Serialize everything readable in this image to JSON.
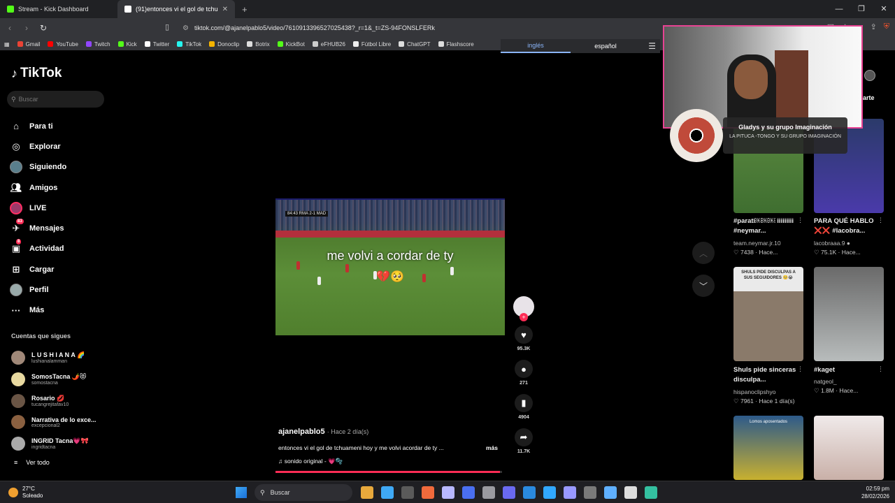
{
  "browser": {
    "tabs": [
      {
        "label": "Stream - Kick Dashboard",
        "color": "#53fc18",
        "active": false
      },
      {
        "label": "(91)entonces vi el gol de tchu",
        "color": "#ffffff",
        "active": true
      }
    ],
    "new_tab": "+",
    "window_controls": [
      "—",
      "❐",
      "✕"
    ],
    "url": "tiktok.com/@ajanelpablo5/video/7610913396527025438?_r=1&_t=ZS-94FONSLFERk",
    "bookmarks": [
      {
        "label": "Gmail",
        "color": "#ea4335"
      },
      {
        "label": "YouTube",
        "color": "#ff0000"
      },
      {
        "label": "Twitch",
        "color": "#9146ff"
      },
      {
        "label": "Kick",
        "color": "#53fc18"
      },
      {
        "label": "Twitter",
        "color": "#ffffff"
      },
      {
        "label": "TikTok",
        "color": "#25f4ee"
      },
      {
        "label": "Donoclip",
        "color": "#f5b400"
      },
      {
        "label": "Botrix",
        "color": "#dddddd"
      },
      {
        "label": "KickBot",
        "color": "#53fc18"
      },
      {
        "label": "eFHUB26",
        "color": "#cccccc"
      },
      {
        "label": "Fútbol Libre",
        "color": "#eeeeee"
      },
      {
        "label": "ChatGPT",
        "color": "#dddddd"
      },
      {
        "label": "Flashscore",
        "color": "#dddddd"
      }
    ],
    "translate": {
      "from": "inglés",
      "to": "español"
    }
  },
  "sidebar": {
    "logo": "TikTok",
    "search_placeholder": "Buscar",
    "nav": [
      {
        "label": "Para ti",
        "icon": "home-icon"
      },
      {
        "label": "Explorar",
        "icon": "compass-icon"
      },
      {
        "label": "Siguiendo",
        "icon": "avatar"
      },
      {
        "label": "Amigos",
        "icon": "friends-icon"
      },
      {
        "label": "LIVE",
        "icon": "live-icon"
      },
      {
        "label": "Mensajes",
        "icon": "message-icon",
        "badge": "83"
      },
      {
        "label": "Actividad",
        "icon": "activity-icon",
        "badge": "8"
      },
      {
        "label": "Cargar",
        "icon": "upload-icon"
      },
      {
        "label": "Perfil",
        "icon": "profile-icon"
      },
      {
        "label": "Más",
        "icon": "more-icon"
      }
    ],
    "following_title": "Cuentas que sigues",
    "following": [
      {
        "name": "L U S H I A N A 🌈",
        "handle": "lushianalamman",
        "color": "#a08878"
      },
      {
        "name": "SomosTacna 🌶️😻",
        "handle": "somostacna",
        "color": "#e8d9a0"
      },
      {
        "name": "Rosario 💋",
        "handle": "tucangrejitafav10",
        "color": "#6a5545"
      },
      {
        "name": "Narrativa de lo exce...",
        "handle": "excepcional2",
        "color": "#8a6040"
      },
      {
        "name": "INGRID Tacna💗🎀",
        "handle": "ingridtacna",
        "color": "#aaaaaa"
      }
    ],
    "see_all": "Ver todo"
  },
  "video": {
    "caption": "me volvi a cordar de ty",
    "emoji": "💔🥺",
    "scoreboard": "84:43 RMA 2-1 MAD",
    "author": "ajanelpablo5",
    "ago": "· Hace 2 día(s)",
    "description": "entonces vi el gol de tchuameni hoy y me volvi  acordar  de ty ...",
    "more": "más",
    "sound": "♫  sonido original - 💗🫧",
    "progress_percent": 99,
    "actions": [
      {
        "icon": "heart-icon",
        "glyph": "♥",
        "count": "95.3K"
      },
      {
        "icon": "comment-icon",
        "glyph": "●",
        "count": "271"
      },
      {
        "icon": "bookmark-icon",
        "glyph": "▮",
        "count": "4904"
      },
      {
        "icon": "share-icon",
        "glyph": "➦",
        "count": "11.7K"
      }
    ]
  },
  "right_column": {
    "share_label": "arte",
    "cards": [
      {
        "title": "#parati￼￼￼ iiiiiiiii #neymar...",
        "handle": "team.neymar.jr.10",
        "meta": "♡ 7438 · Hace...",
        "thumb": "#4d7a3a"
      },
      {
        "title": "PARA QUÉ HABLO ❌❌ #lacobra...",
        "handle": "lacobraaa.9 ●",
        "meta": "♡ 75.1K · Hace...",
        "thumb": "#2b3a6a"
      },
      {
        "title": "Shuls pide sinceras disculpa...",
        "handle": "hispanoclipshyo",
        "meta": "♡ 7961 · Hace 1 día(s)",
        "thumb": "#8a7a6a",
        "banner": "SHULS PIDE DISCULPAS A SUS SEGUIDORES 🥺😭"
      },
      {
        "title": "#kaget",
        "handle": "natgeol_",
        "meta": "♡ 1.8M · Hace...",
        "thumb": "#9aa0a0"
      },
      {
        "title": "",
        "handle": "",
        "meta": "",
        "thumb": "#c8b030",
        "banner": "Lomos aposentados"
      },
      {
        "title": "",
        "handle": "",
        "meta": "",
        "thumb": "#e9e3e3"
      }
    ]
  },
  "music_overlay": {
    "song": "Gladys y su grupo Imaginación",
    "artist": "LA PITUCA -TONGO Y SU GRUPO IMAGINACIÓN"
  },
  "taskbar": {
    "temp": "27°C",
    "weather": "Soleado",
    "search": "Buscar",
    "time": "02:59 pm",
    "date": "28/02/2026",
    "apps": [
      "#e8a93c",
      "#3fa9f5",
      "#5a5a5a",
      "#f06a3c",
      "#b8b8ff",
      "#4a6ff0",
      "#9a9aa0",
      "#6a6af0",
      "#2a8adf",
      "#31a8ff",
      "#9999ff",
      "#7a7a7a",
      "#5fb0ff",
      "#dddddd",
      "#34c0a0"
    ]
  }
}
